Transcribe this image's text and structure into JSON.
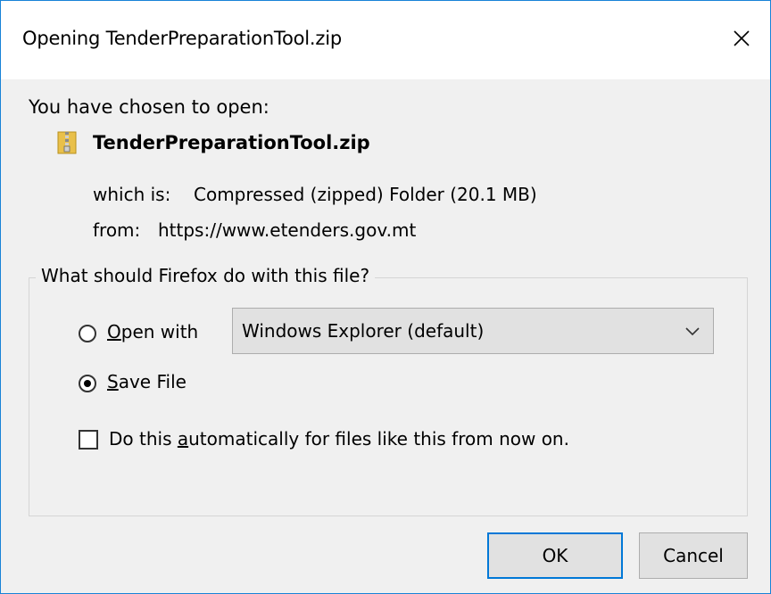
{
  "window": {
    "title": "Opening TenderPreparationTool.zip"
  },
  "intro": "You have chosen to open:",
  "file": {
    "name": "TenderPreparationTool.zip",
    "which_is_label": "which is:",
    "which_is_value": "Compressed (zipped) Folder (20.1 MB)",
    "from_label": "from:",
    "from_value": "https://www.etenders.gov.mt",
    "icon": "zip-folder-icon"
  },
  "action_group": {
    "legend": "What should Firefox do with this file?",
    "open_with": {
      "prefix": "",
      "accel": "O",
      "rest": "pen with",
      "selected": false,
      "app": "Windows Explorer (default)"
    },
    "save_file": {
      "accel": "S",
      "rest": "ave File",
      "selected": true
    },
    "auto_checkbox": {
      "pre": "Do this ",
      "accel": "a",
      "post": "utomatically for files like this from now on.",
      "checked": false
    }
  },
  "buttons": {
    "ok": "OK",
    "cancel": "Cancel"
  },
  "colors": {
    "border": "#1883d7",
    "accent": "#0078d7",
    "zip_icon": "#e9c04a"
  }
}
